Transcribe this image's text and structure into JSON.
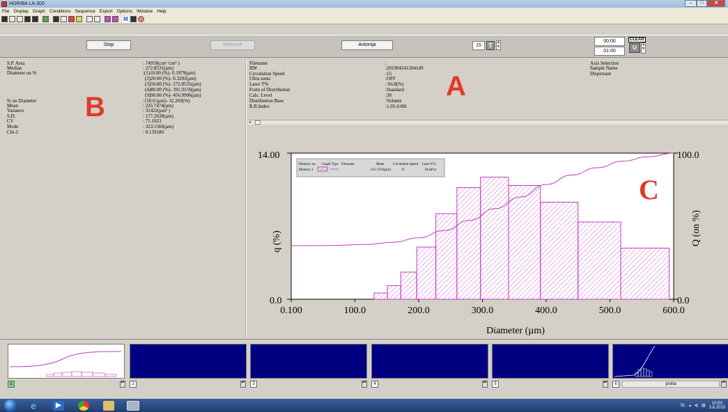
{
  "window": {
    "title": "HORIBA LA-300"
  },
  "menu": [
    "File",
    "Display",
    "Graph",
    "Conditions",
    "Sequence",
    "Export",
    "Options",
    "Window",
    "Help"
  ],
  "controls": {
    "stop_label": "Stop",
    "measure_label": "Measure",
    "sample_label": "Antonija",
    "circulation_value": "15",
    "time_top": "00:00",
    "time_bottom": "01:00",
    "clear_label": "CLEAR"
  },
  "panel_b": {
    "letter": "B",
    "rows": [
      {
        "label": "S.P. Area",
        "value": ": 74918(cm² /cm³ )"
      },
      {
        "label": "Median",
        "value": ": 272.8531(µm)"
      },
      {
        "label": "Diameter on %",
        "value": ":(1)10.00 (%)- 0.1979(µm)"
      },
      {
        "label": "",
        "value": "(2)20.00 (%)- 0.3293(µm)"
      },
      {
        "label": "",
        "value": "(3)50.00 (%)- 272.8531(µm)"
      },
      {
        "label": "",
        "value": "(4)80.00 (%)- 391.9159(µm)"
      },
      {
        "label": "",
        "value": "(9)90.00 (%)- 456.9906(µm)"
      },
      {
        "label": "% on Diameter",
        "value": ":150.0 (µm)- 31.269(%)"
      },
      {
        "label": "Mean",
        "value": ": 235.7474(µm)"
      },
      {
        "label": "Variance",
        "value": ": 31422(µm² )"
      },
      {
        "label": "S.D.",
        "value": ": 177.2638(µm)"
      },
      {
        "label": "CV",
        "value": ": 75.1923"
      },
      {
        "label": "Mode",
        "value": ": 323.1566(µm)"
      },
      {
        "label": "Chi-2",
        "value": ": 0.139180"
      }
    ]
  },
  "panel_a": {
    "letter": "A",
    "rows": [
      {
        "label": "Filename",
        "value": ":"
      },
      {
        "label": "ID#",
        "value": ":201904241204149"
      },
      {
        "label": "Circulation Speed",
        "value": ":15"
      },
      {
        "label": "Ultra sonic",
        "value": ":OFF"
      },
      {
        "label": "Laser T%",
        "value": ": 66.8(%)"
      },
      {
        "label": "Form of Distribution",
        "value": ":Standard"
      },
      {
        "label": "Calc. Level",
        "value": ":30"
      },
      {
        "label": "Distribution Base",
        "value": ":Volume"
      },
      {
        "label": "R.R.Index",
        "value": ":1.05-0.00i"
      }
    ],
    "right_labels": [
      "Axis Selection",
      "Sample Name",
      "Dispersant"
    ]
  },
  "chart_letter": "C",
  "chart_data": {
    "type": "bar",
    "xlabel": "Diameter (µm)",
    "ylabel": "q (%)",
    "y2label": "Q (on %)",
    "x_tick_labels": [
      "0.100",
      "100.0",
      "200.0",
      "300.0",
      "400.0",
      "500.0",
      "600.0"
    ],
    "x_ticks": [
      0.1,
      100,
      200,
      300,
      400,
      500,
      600
    ],
    "xlim": [
      0.1,
      600
    ],
    "ylim": [
      0,
      14
    ],
    "y_tick_labels": [
      "0.0",
      "14.00"
    ],
    "y2lim": [
      0,
      100
    ],
    "y2_tick_labels": [
      "0.0",
      "100.0"
    ],
    "bins": [
      {
        "x0": 130,
        "x1": 151,
        "q": 0.6
      },
      {
        "x0": 151,
        "x1": 172,
        "q": 1.3
      },
      {
        "x0": 172,
        "x1": 197,
        "q": 2.6
      },
      {
        "x0": 197,
        "x1": 227,
        "q": 5.0
      },
      {
        "x0": 227,
        "x1": 260,
        "q": 8.2
      },
      {
        "x0": 260,
        "x1": 297,
        "q": 10.7
      },
      {
        "x0": 297,
        "x1": 341,
        "q": 11.7
      },
      {
        "x0": 341,
        "x1": 391,
        "q": 10.9
      },
      {
        "x0": 391,
        "x1": 450,
        "q": 9.3
      },
      {
        "x0": 450,
        "x1": 517,
        "q": 7.4
      },
      {
        "x0": 517,
        "x1": 593,
        "q": 4.9
      }
    ],
    "cumulative": {
      "x": [
        0.1,
        60,
        120,
        160,
        200,
        240,
        280,
        320,
        360,
        400,
        440,
        480,
        520,
        560,
        600
      ],
      "Q": [
        36.6,
        36.8,
        37.5,
        39.0,
        42.0,
        47.0,
        54.0,
        62.0,
        70.0,
        78.5,
        85.0,
        90.0,
        94.5,
        97.5,
        100.0
      ]
    },
    "legend": {
      "headers": [
        "Memory no.",
        "Graph Type",
        "Filename",
        "Mean",
        "Circulation Speed",
        "Laser T%"
      ],
      "row": {
        "memory": "Memory 1",
        "filename": "",
        "mean": "235.7474(µm)",
        "speed": "15",
        "laser": "66.8(%)"
      }
    }
  },
  "thumbnails": [
    {
      "num": "1",
      "name": "",
      "type": "white"
    },
    {
      "num": "2",
      "name": "",
      "type": "blue"
    },
    {
      "num": "3",
      "name": "",
      "type": "blue"
    },
    {
      "num": "4",
      "name": "",
      "type": "blue"
    },
    {
      "num": "5",
      "name": "",
      "type": "blue"
    },
    {
      "num": "6",
      "name": "proba",
      "type": "blue"
    }
  ],
  "taskbar": {
    "lang": "SL",
    "time": "10:53",
    "date": "3.6.2019"
  },
  "colors": {
    "series": "#c03cc0",
    "thumb_bg": "#000080",
    "annotation": "#e03a2c"
  }
}
